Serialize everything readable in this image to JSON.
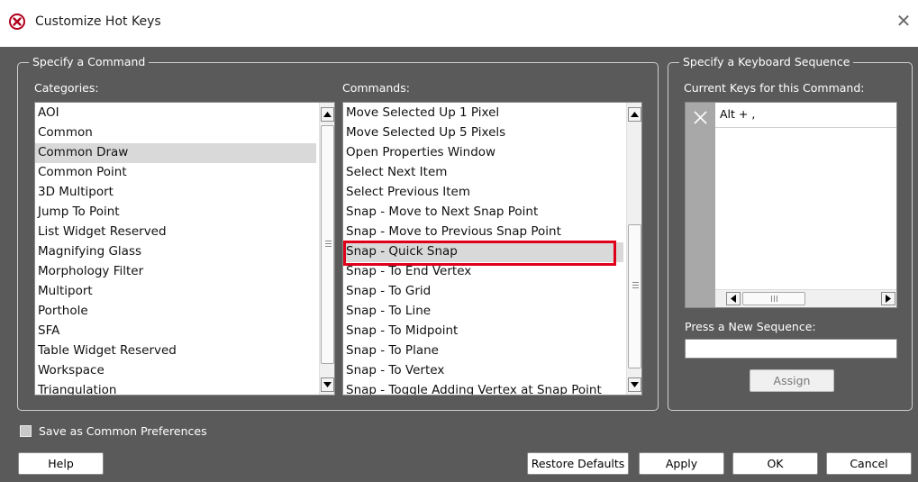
{
  "window": {
    "title": "Customize Hot Keys",
    "close_glyph": "✕"
  },
  "command_group": {
    "legend": "Specify a Command",
    "categories_label": "Categories:",
    "commands_label": "Commands:",
    "categories": [
      "AOI",
      "Common",
      "Common Draw",
      "Common Point",
      "3D Multiport",
      "Jump To Point",
      "List Widget Reserved",
      "Magnifying Glass",
      "Morphology Filter",
      "Multiport",
      "Porthole",
      "SFA",
      "Table Widget Reserved",
      "Workspace",
      "Triangulation"
    ],
    "selected_category": "Common Draw",
    "commands": [
      "Move Selected Up 1 Pixel",
      "Move Selected Up 5 Pixels",
      "Open Properties Window",
      "Select Next Item",
      "Select Previous Item",
      "Snap - Move to Next Snap Point",
      "Snap - Move to Previous Snap Point",
      "Snap - Quick Snap",
      "Snap - To End Vertex",
      "Snap - To Grid",
      "Snap - To Line",
      "Snap - To Midpoint",
      "Snap - To Plane",
      "Snap - To Vertex",
      "Snap - Toggle Adding Vertex at Snap Point"
    ],
    "selected_command": "Snap - Quick Snap"
  },
  "sequence_group": {
    "legend": "Specify a Keyboard Sequence",
    "current_keys_label": "Current Keys for this Command:",
    "current_keys": [
      "Alt + ,"
    ],
    "press_new_label": "Press a New Sequence:",
    "new_sequence_value": "",
    "assign_label": "Assign"
  },
  "footer": {
    "save_common_label": "Save as Common Preferences",
    "save_common_checked": false,
    "help_label": "Help",
    "restore_label": "Restore Defaults",
    "apply_label": "Apply",
    "ok_label": "OK",
    "cancel_label": "Cancel"
  },
  "colors": {
    "dialog_bg": "#5a5a5a",
    "highlight": "#e0001a",
    "selection": "#d9d9d9"
  },
  "icons": {
    "title_icon": "error-x-circle-icon",
    "remove_key_icon": "x-icon"
  }
}
